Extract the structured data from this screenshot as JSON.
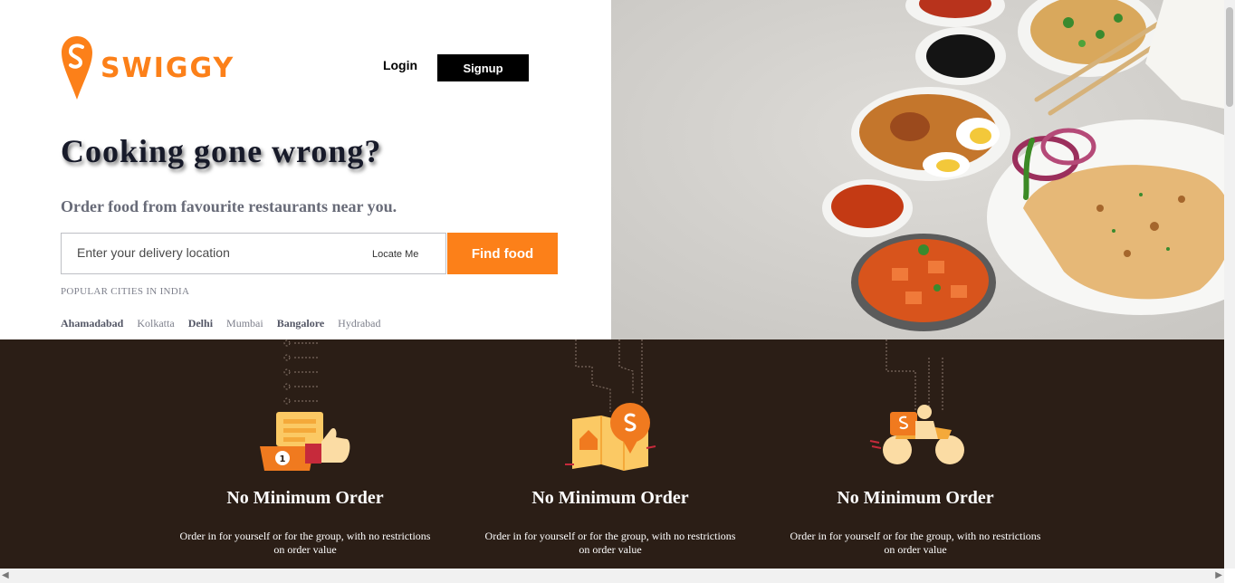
{
  "brand": {
    "name": "SWIGGY",
    "color": "#fc8019"
  },
  "nav": {
    "login_label": "Login",
    "signup_label": "Signup"
  },
  "hero": {
    "headline": "Cooking gone wrong?",
    "subtitle": "Order food from favourite restaurants near you.",
    "search": {
      "placeholder": "Enter your delivery location",
      "value": "",
      "locate_label": "Locate Me",
      "button_label": "Find food"
    },
    "popular_heading": "POPULAR CITIES IN INDIA",
    "cities": [
      {
        "name": "Ahamadabad"
      },
      {
        "name": "Kolkatta"
      },
      {
        "name": "Delhi"
      },
      {
        "name": "Mumbai"
      },
      {
        "name": "Bangalore"
      },
      {
        "name": "Hydrabad"
      }
    ],
    "image_icon": "food-platter-image"
  },
  "features": [
    {
      "title": "No Minimum Order",
      "description": "Order in for yourself or for the group, with no restrictions on order value",
      "icon": "order-thumbs-up-icon"
    },
    {
      "title": "No Minimum Order",
      "description": "Order in for yourself or for the group, with no restrictions on order value",
      "icon": "map-location-pin-icon"
    },
    {
      "title": "No Minimum Order",
      "description": "Order in for yourself or for the group, with no restrictions on order value",
      "icon": "delivery-scooter-icon"
    }
  ],
  "colors": {
    "accent": "#fc8019",
    "dark_panel": "#2b1e16",
    "headline": "#171a29",
    "muted": "#686b78"
  }
}
